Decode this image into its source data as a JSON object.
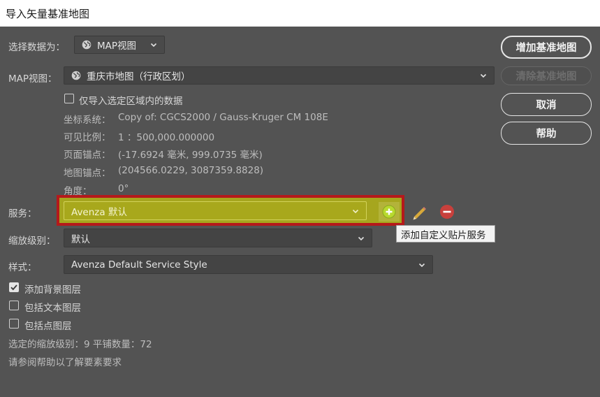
{
  "window": {
    "title": "导入矢量基准地图"
  },
  "select_data": {
    "label": "选择数据为：",
    "value": "MAP视图"
  },
  "map_view": {
    "label": "MAP视图：",
    "value": "重庆市地图（行政区划）"
  },
  "only_selected": {
    "label": "仅导入选定区域内的数据",
    "checked": false
  },
  "info": {
    "coord_label": "坐标系统：",
    "coord_value": "Copy of: CGCS2000 / Gauss-Kruger CM 108E",
    "scale_label": "可见比例：",
    "scale_value": "1 ：500,000.000000",
    "page_anchor_label": "页面锚点：",
    "page_anchor_value": "(-17.6924 毫米, 999.0735 毫米)",
    "map_anchor_label": "地图锚点：",
    "map_anchor_value": "(204566.0229, 3087359.8828)",
    "angle_label": "角度：",
    "angle_value": "0°"
  },
  "service": {
    "label": "服务：",
    "value": "Avenza 默认"
  },
  "tooltip": {
    "text": "添加自定义贴片服务"
  },
  "zoom": {
    "label": "缩放级别：",
    "value": "默认"
  },
  "style": {
    "label": "样式：",
    "value": "Avenza Default Service Style"
  },
  "layers": [
    {
      "label": "添加背景图层",
      "checked": true
    },
    {
      "label": "包括文本图层",
      "checked": false
    },
    {
      "label": "包括点图层",
      "checked": false
    }
  ],
  "footer": {
    "selected_zoom": "选定的缩放级别：9 平铺数量：72",
    "help_note": "请参阅帮助以了解要素要求"
  },
  "buttons": {
    "add_basemap": "增加基准地图",
    "clear_basemap": "清除基准地图",
    "cancel": "取消",
    "help": "帮助"
  },
  "colors": {
    "background": "#535353",
    "highlight_border": "#b5191b",
    "service_fill": "#a8a81c",
    "add_icon": "#b8d92e",
    "remove_icon": "#c8403c"
  }
}
